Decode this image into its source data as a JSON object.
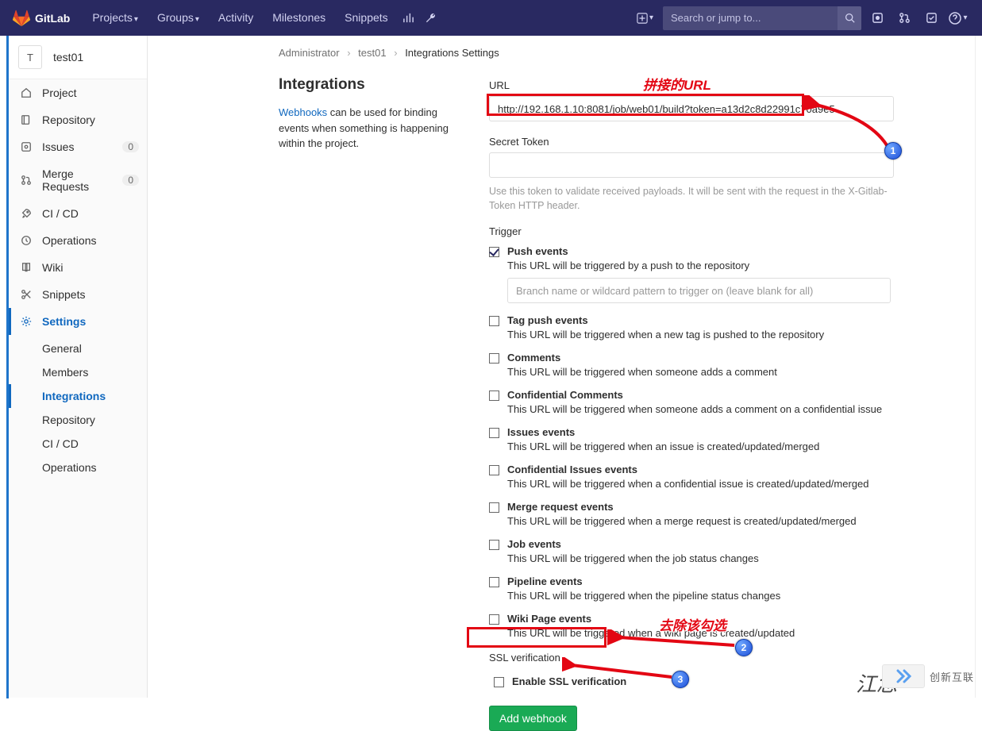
{
  "nav": {
    "brand": "GitLab",
    "projects": "Projects",
    "groups": "Groups",
    "activity": "Activity",
    "milestones": "Milestones",
    "snippets": "Snippets",
    "search_placeholder": "Search or jump to..."
  },
  "project": {
    "letter": "T",
    "name": "test01"
  },
  "sidebar": {
    "project": "Project",
    "repository": "Repository",
    "issues": "Issues",
    "issues_count": "0",
    "merge_requests": "Merge Requests",
    "mr_count": "0",
    "cicd": "CI / CD",
    "operations": "Operations",
    "wiki": "Wiki",
    "snippets": "Snippets",
    "settings": "Settings",
    "sub": {
      "general": "General",
      "members": "Members",
      "integrations": "Integrations",
      "repository": "Repository",
      "cicd": "CI / CD",
      "operations": "Operations"
    }
  },
  "breadcrumb": {
    "a": "Administrator",
    "b": "test01",
    "c": "Integrations Settings"
  },
  "intro": {
    "title": "Integrations",
    "link": "Webhooks",
    "text": " can be used for binding events when something is happening within the project."
  },
  "form": {
    "url_label": "URL",
    "url_value": "http://192.168.1.10:8081/job/web01/build?token=a13d2c8d22991c70a9e5",
    "secret_label": "Secret Token",
    "secret_help": "Use this token to validate received payloads. It will be sent with the request in the X-Gitlab-Token HTTP header.",
    "trigger_label": "Trigger",
    "branch_placeholder": "Branch name or wildcard pattern to trigger on (leave blank for all)",
    "ssl_label": "SSL verification",
    "ssl_check": "Enable SSL verification",
    "submit": "Add webhook"
  },
  "triggers": {
    "push": {
      "t": "Push events",
      "d": "This URL will be triggered by a push to the repository"
    },
    "tag": {
      "t": "Tag push events",
      "d": "This URL will be triggered when a new tag is pushed to the repository"
    },
    "comments": {
      "t": "Comments",
      "d": "This URL will be triggered when someone adds a comment"
    },
    "conf_comments": {
      "t": "Confidential Comments",
      "d": "This URL will be triggered when someone adds a comment on a confidential issue"
    },
    "issues": {
      "t": "Issues events",
      "d": "This URL will be triggered when an issue is created/updated/merged"
    },
    "conf_issues": {
      "t": "Confidential Issues events",
      "d": "This URL will be triggered when a confidential issue is created/updated/merged"
    },
    "mr": {
      "t": "Merge request events",
      "d": "This URL will be triggered when a merge request is created/updated/merged"
    },
    "job": {
      "t": "Job events",
      "d": "This URL will be triggered when the job status changes"
    },
    "pipeline": {
      "t": "Pipeline events",
      "d": "This URL will be triggered when the pipeline status changes"
    },
    "wiki": {
      "t": "Wiki Page events",
      "d": "This URL will be triggered when a wiki page is created/updated"
    }
  },
  "annotations": {
    "url_note": "拼接的URL",
    "ssl_note": "去除该勾选",
    "n1": "1",
    "n2": "2",
    "n3": "3",
    "sig": "江念",
    "wm": "创新互联"
  }
}
